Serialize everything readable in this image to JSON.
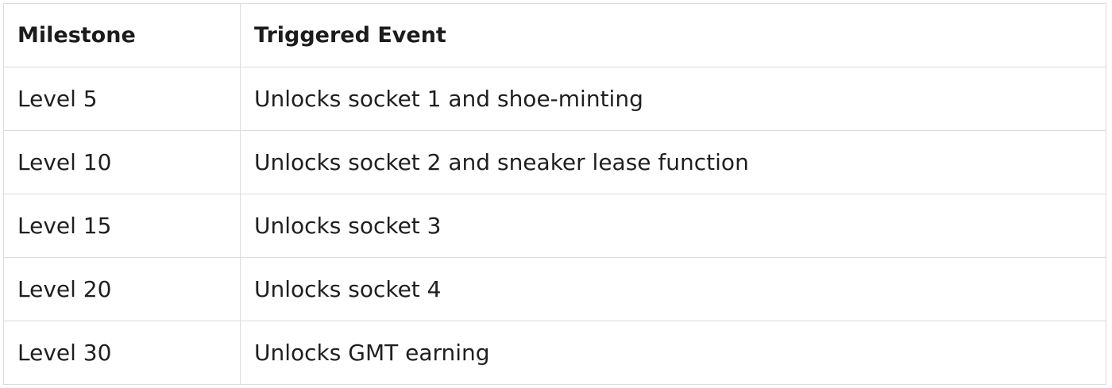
{
  "table": {
    "headers": {
      "milestone": "Milestone",
      "event": "Triggered Event"
    },
    "rows": [
      {
        "milestone": "Level 5",
        "event": "Unlocks socket 1 and shoe-minting"
      },
      {
        "milestone": "Level 10",
        "event": "Unlocks socket 2 and sneaker lease function"
      },
      {
        "milestone": "Level 15",
        "event": "Unlocks socket 3"
      },
      {
        "milestone": "Level 20",
        "event": "Unlocks socket 4"
      },
      {
        "milestone": "Level 30",
        "event": "Unlocks GMT earning"
      }
    ]
  }
}
